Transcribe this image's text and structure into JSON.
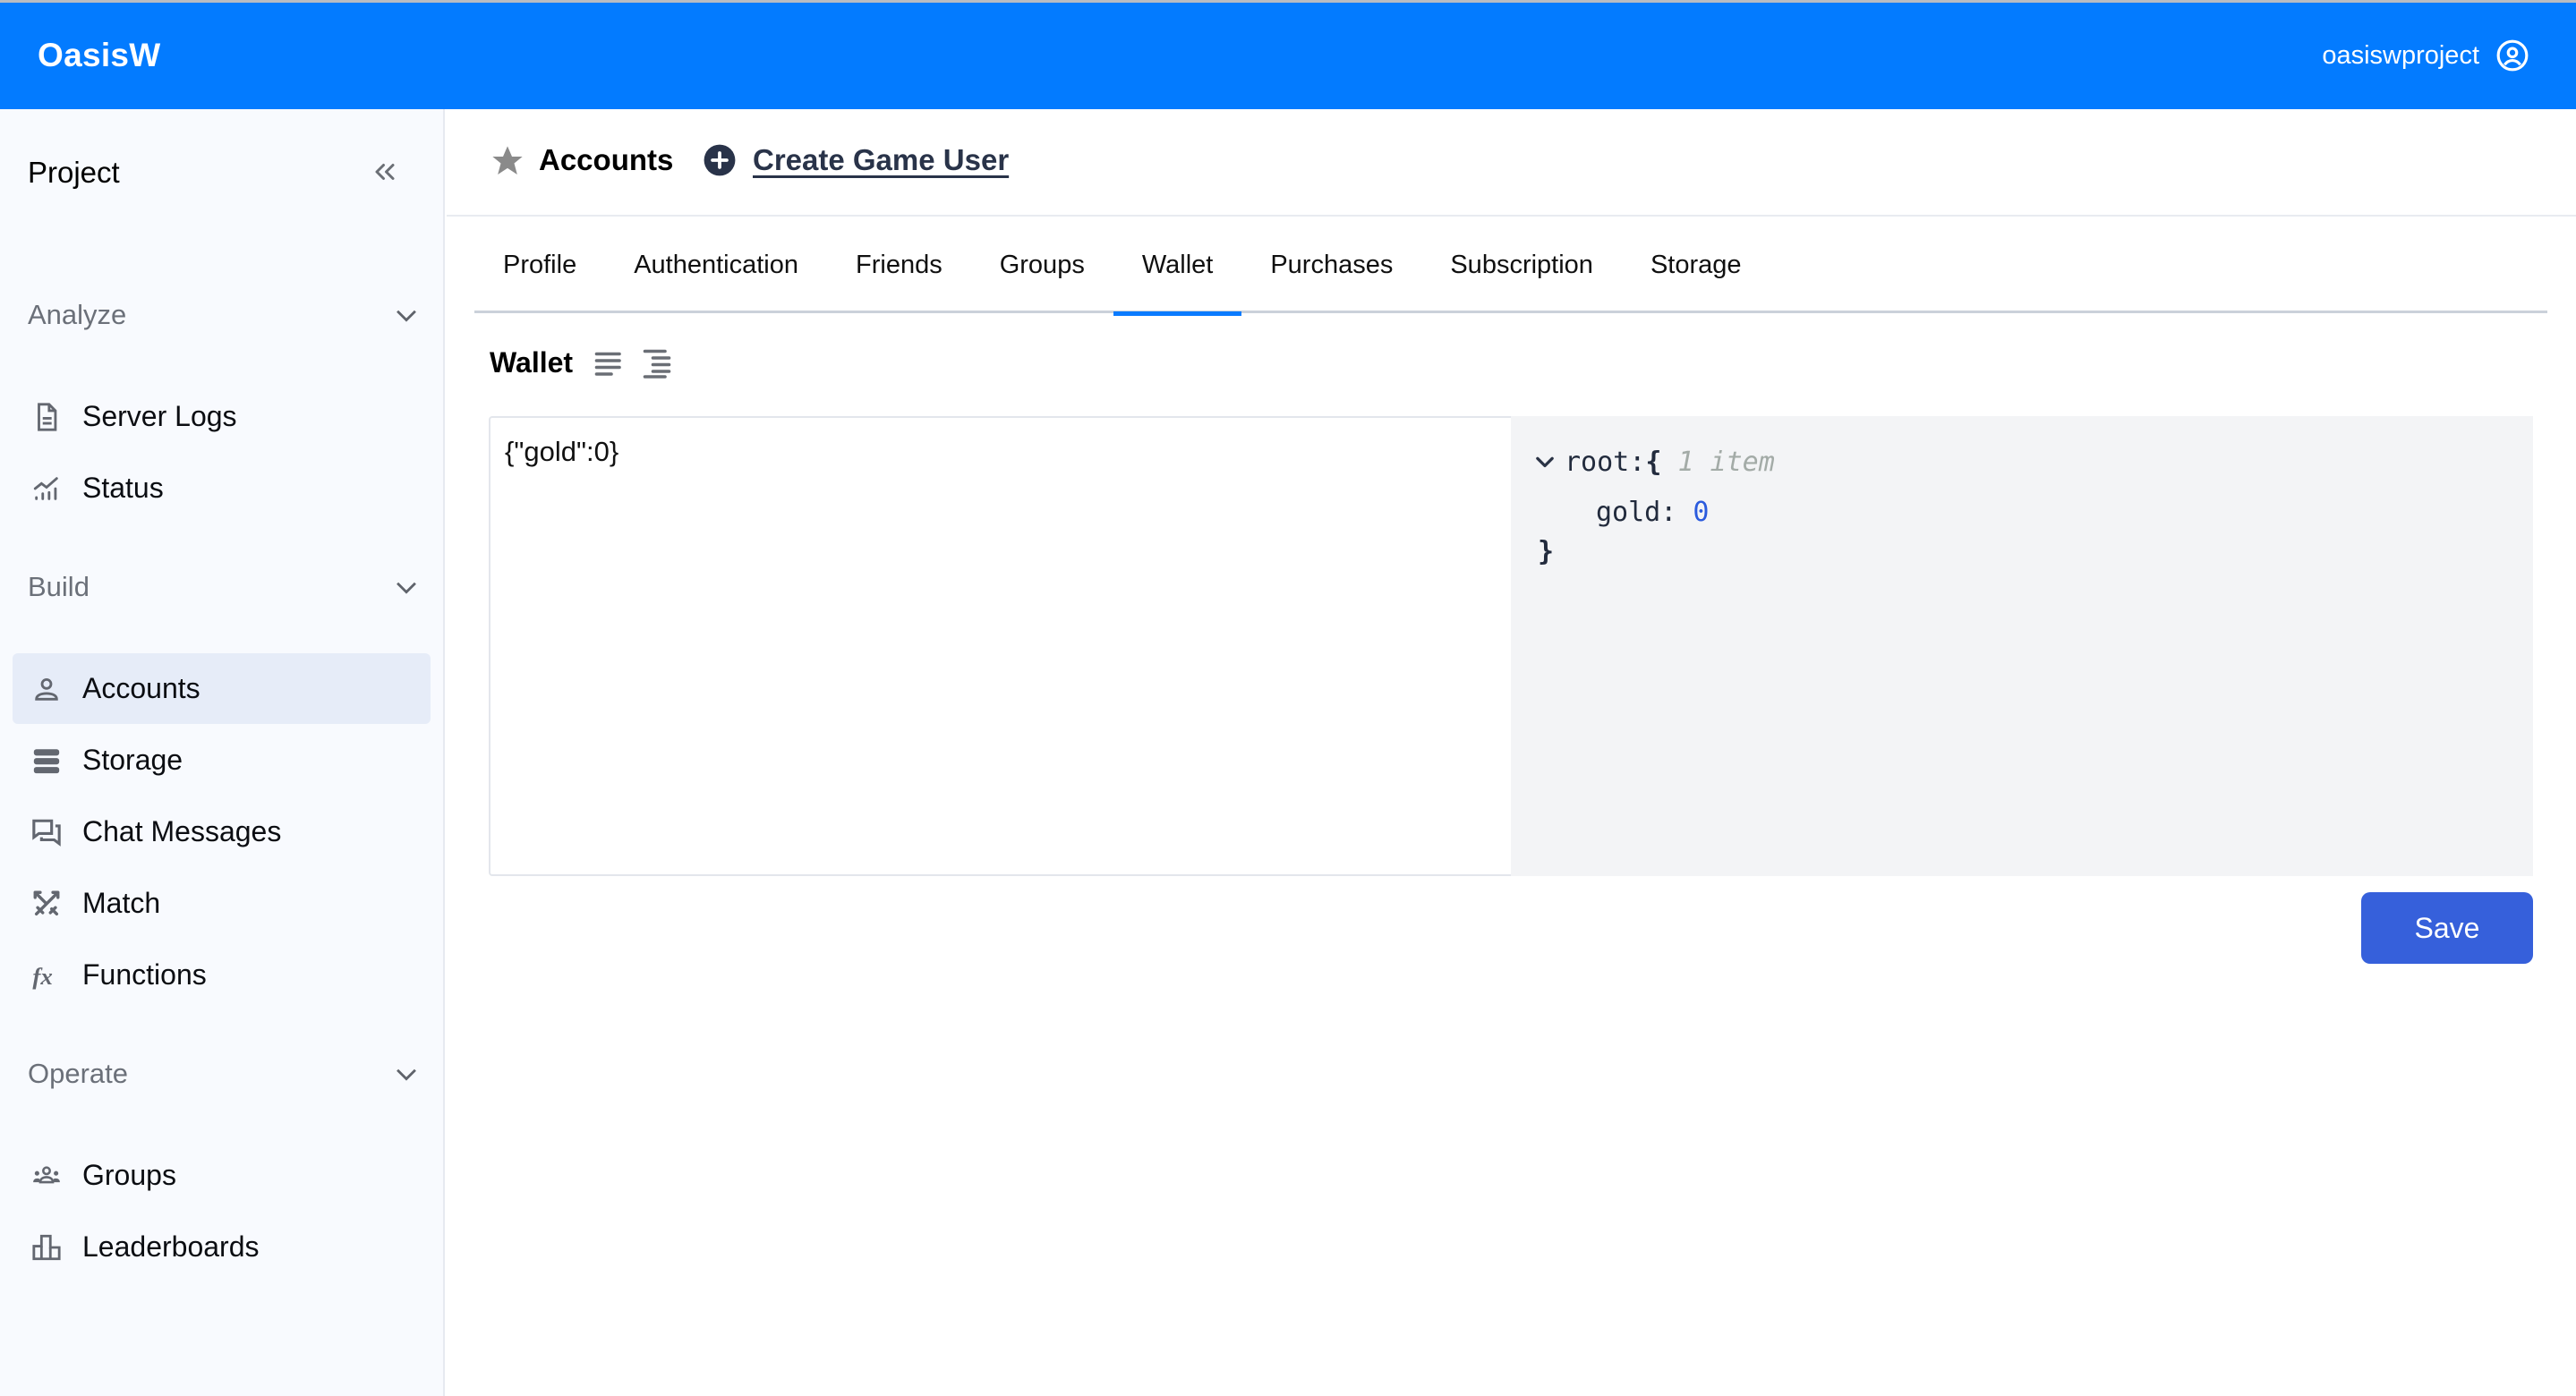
{
  "header": {
    "brand": "OasisW",
    "username": "oasiswproject",
    "user_icon": "user-circle-icon",
    "colors": {
      "bar": "#037BFF"
    }
  },
  "sidebar": {
    "title": "Project",
    "collapse_icon": "chevrons-left-icon",
    "sections": [
      {
        "label": "Analyze",
        "items": [
          {
            "label": "Server Logs",
            "icon": "document-icon"
          },
          {
            "label": "Status",
            "icon": "chart-line-icon"
          }
        ]
      },
      {
        "label": "Build",
        "items": [
          {
            "label": "Accounts",
            "icon": "user-icon",
            "active": true
          },
          {
            "label": "Storage",
            "icon": "database-icon"
          },
          {
            "label": "Chat Messages",
            "icon": "chat-icon"
          },
          {
            "label": "Match",
            "icon": "swords-icon"
          },
          {
            "label": "Functions",
            "icon": "function-icon"
          }
        ]
      },
      {
        "label": "Operate",
        "items": [
          {
            "label": "Groups",
            "icon": "users-icon"
          },
          {
            "label": "Leaderboards",
            "icon": "leaderboard-icon"
          }
        ]
      }
    ]
  },
  "page": {
    "title": "Accounts",
    "create_label": "Create Game User",
    "tabs": [
      {
        "label": "Profile"
      },
      {
        "label": "Authentication"
      },
      {
        "label": "Friends"
      },
      {
        "label": "Groups"
      },
      {
        "label": "Wallet",
        "active": true
      },
      {
        "label": "Purchases"
      },
      {
        "label": "Subscription"
      },
      {
        "label": "Storage"
      }
    ]
  },
  "wallet": {
    "heading": "Wallet",
    "editor_value": "{\"gold\":0}",
    "viewer": {
      "root_label": "root:",
      "open_brace": "{",
      "count_label": "1 item",
      "key": "gold:",
      "value": "0",
      "close_brace": "}"
    },
    "save_label": "Save",
    "colors": {
      "save": "#3660DB",
      "number": "#2B5BDD"
    }
  }
}
